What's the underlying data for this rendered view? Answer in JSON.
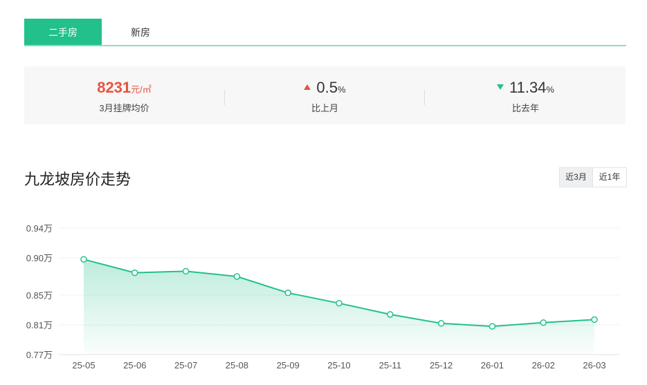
{
  "tabs": [
    {
      "label": "二手房",
      "active": true
    },
    {
      "label": "新房",
      "active": false
    }
  ],
  "stats": {
    "avg_price": {
      "value": "8231",
      "unit": "元/㎡",
      "label": "3月挂牌均价"
    },
    "mom": {
      "value": "0.5",
      "unit": "%",
      "label": "比上月",
      "direction": "up"
    },
    "yoy": {
      "value": "11.34",
      "unit": "%",
      "label": "比去年",
      "direction": "down"
    }
  },
  "chart_header": {
    "title": "九龙坡房价走势",
    "ranges": [
      "近3月",
      "近1年"
    ],
    "selected_range": "近3月"
  },
  "colors": {
    "accent": "#22c08a",
    "up": "#e8533f",
    "down": "#22c08a"
  },
  "chart_data": {
    "type": "area",
    "categories": [
      "25-05",
      "25-06",
      "25-07",
      "25-08",
      "25-09",
      "25-10",
      "25-11",
      "25-12",
      "26-01",
      "26-02",
      "26-03"
    ],
    "series": [
      {
        "values": [
          0.898,
          0.88,
          0.882,
          0.875,
          0.853,
          0.839,
          0.824,
          0.812,
          0.808,
          0.813,
          0.817
        ]
      }
    ],
    "yticks": [
      "0.94万",
      "0.90万",
      "0.85万",
      "0.81万",
      "0.77万"
    ],
    "ylim": [
      0.77,
      0.94
    ],
    "grid": true,
    "xlabel": "",
    "ylabel": ""
  }
}
